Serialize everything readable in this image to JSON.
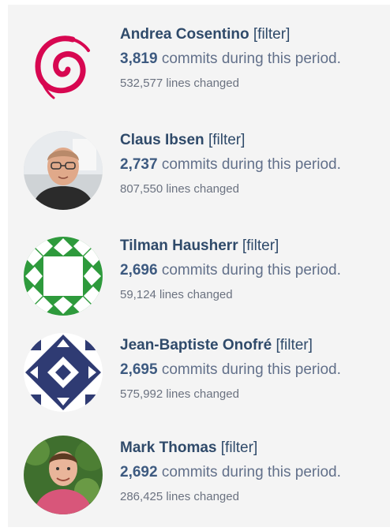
{
  "contributors": [
    {
      "name": "Andrea Cosentino",
      "filter_label": "[filter]",
      "commits": "3,819",
      "commits_suffix": " commits during this period.",
      "lines_changed": "532,577 lines changed",
      "avatar": "debian-swirl-icon",
      "accent": "#d70751"
    },
    {
      "name": "Claus Ibsen",
      "filter_label": "[filter]",
      "commits": "2,737",
      "commits_suffix": " commits during this period.",
      "lines_changed": "807,550 lines changed",
      "avatar": "person-photo"
    },
    {
      "name": "Tilman Hausherr",
      "filter_label": "[filter]",
      "commits": "2,696",
      "commits_suffix": " commits during this period.",
      "lines_changed": "59,124 lines changed",
      "avatar": "identicon-green",
      "accent": "#2e9a3c"
    },
    {
      "name": "Jean-Baptiste Onofré",
      "filter_label": "[filter]",
      "commits": "2,695",
      "commits_suffix": " commits during this period.",
      "lines_changed": "575,992 lines changed",
      "avatar": "identicon-navy",
      "accent": "#2f3b73"
    },
    {
      "name": "Mark Thomas",
      "filter_label": "[filter]",
      "commits": "2,692",
      "commits_suffix": " commits during this period.",
      "lines_changed": "286,425 lines changed",
      "avatar": "person-photo"
    }
  ]
}
